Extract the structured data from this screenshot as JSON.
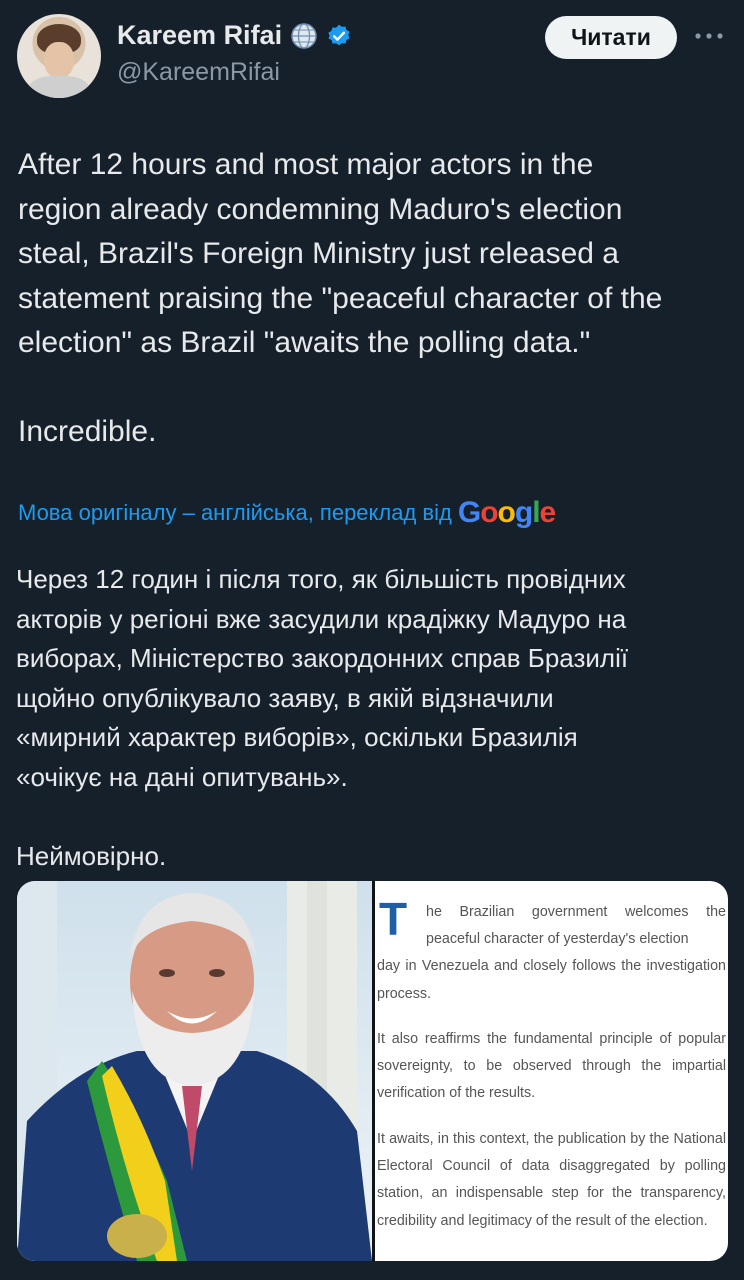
{
  "author": {
    "name": "Kareem Rifai",
    "handle": "@KareemRifai"
  },
  "follow_button": {
    "label": "Читати"
  },
  "icons": {
    "globe": "globe-icon",
    "verified": "verified-badge-icon",
    "more": "more-options-icon",
    "google": "google-logo"
  },
  "tweet": {
    "text": "After 12 hours and most major actors in the\nregion already condemning Maduro's election\nsteal, Brazil's Foreign Ministry just released a\nstatement praising the \"peaceful character of the\nelection\" as Brazil \"awaits the polling data.\"\n\nIncredible."
  },
  "translation": {
    "attribution": "Мова оригіналу – англійська, переклад від",
    "provider": "Google",
    "text": "Через 12 годин і після того, як більшість провідних\nакторів у регіоні вже засудили крадіжку Мадуро на\nвиборах, Міністерство закордонних справ Бразилії\nщойно опублікувало заяву, в якій відзначили\n«мирний характер виборів», оскільки Бразилія\n«очікує на дані опитувань».\n\nНеймовірно."
  },
  "statement_image": {
    "drop_cap": "T",
    "p1_first": "he Brazilian government welcomes the peaceful character of yesterday's election",
    "p1_rest": "day in Venezuela and closely follows the investigation process.",
    "p2": "It also reaffirms the fundamental principle of popular sovereignty, to be observed through the impartial verification of the results.",
    "p3": "It awaits, in this context, the publication by the National Electoral Council of data disaggregated by polling station, an indispensable step for the transparency, credibility and legitimacy of the result of the election."
  },
  "colors": {
    "background": "#15202b",
    "text": "#e7e9ea",
    "secondary_text": "#8b98a5",
    "link": "#1d9bf0",
    "verified": "#1d9bf0",
    "button_bg": "#eff3f4"
  }
}
